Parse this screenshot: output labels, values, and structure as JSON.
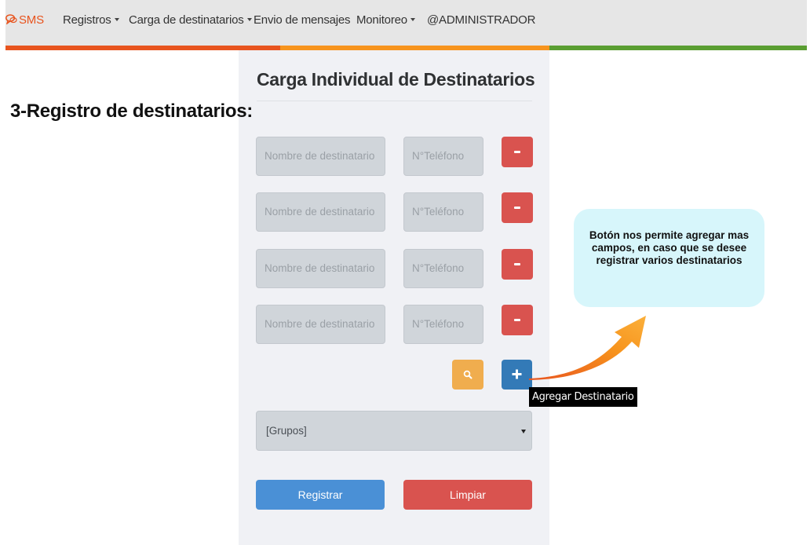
{
  "navbar": {
    "brand": "SMS",
    "items": [
      {
        "label": "Registros"
      },
      {
        "label": "Carga de destinatarios"
      },
      {
        "label": "Envio de mensajes"
      },
      {
        "label": "Monitoreo"
      },
      {
        "label": "@ADMINISTRADOR"
      }
    ],
    "stripe_colors": [
      "#e8541e",
      "#f7941d",
      "#5a9e32"
    ]
  },
  "section_title": "3-Registro de destinatarios:",
  "form": {
    "title": "Carga Individual de Destinatarios",
    "rows": [
      {
        "name_placeholder": "Nombre de destinatario",
        "phone_placeholder": "N°Teléfono"
      },
      {
        "name_placeholder": "Nombre de destinatario",
        "phone_placeholder": "N°Teléfono"
      },
      {
        "name_placeholder": "Nombre de destinatario",
        "phone_placeholder": "N°Teléfono"
      },
      {
        "name_placeholder": "Nombre de destinatario",
        "phone_placeholder": "N°Teléfono"
      }
    ],
    "add_tooltip": "Agregar Destinatario",
    "group_select": "[Grupos]",
    "register_label": "Registrar",
    "clear_label": "Limpiar"
  },
  "callout": "Botón nos permite agregar mas campos, en caso que se desee registrar varios destinatarios",
  "colors": {
    "danger": "#d9534f",
    "warning": "#f0ad4e",
    "primary": "#337ab7",
    "register": "#4a90d6"
  }
}
